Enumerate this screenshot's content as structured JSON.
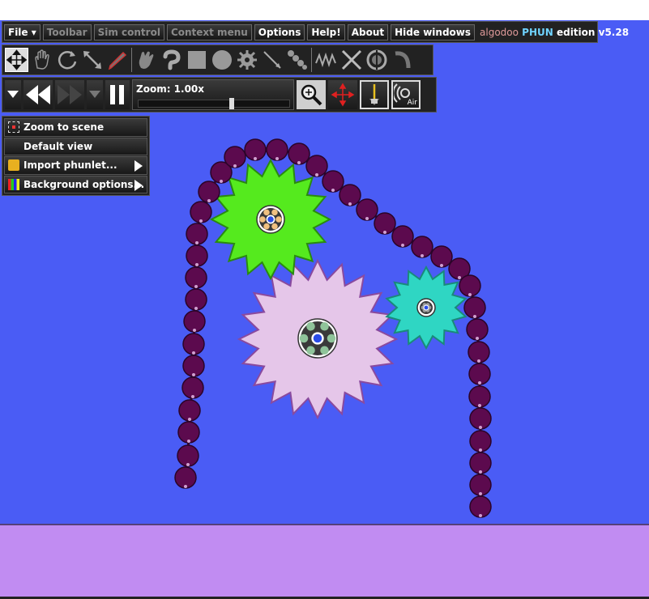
{
  "menubar": {
    "items": [
      {
        "label": "File ▾",
        "enabled": true
      },
      {
        "label": "Toolbar",
        "enabled": false
      },
      {
        "label": "Sim control",
        "enabled": false
      },
      {
        "label": "Context menu",
        "enabled": false
      },
      {
        "label": "Options",
        "enabled": true
      },
      {
        "label": "Help!",
        "enabled": true
      },
      {
        "label": "About",
        "enabled": true
      },
      {
        "label": "Hide windows",
        "enabled": true
      }
    ],
    "brand_prefix": "algodoo",
    "brand_name": "PHUN",
    "brand_suffix": "edition v5.28"
  },
  "toolbar": {
    "tools": [
      "move-tool-icon",
      "drag-hand-icon",
      "rotate-icon",
      "scale-icon",
      "sketch-pen-icon",
      "brush-icon",
      "plane-icon",
      "box-icon",
      "circle-icon",
      "gear-icon",
      "cut-knife-icon",
      "chain-icon",
      "spring-icon",
      "delete-x-icon",
      "fixate-icon",
      "tracer-icon"
    ],
    "selected": "move-tool-icon"
  },
  "sim": {
    "zoom_label": "Zoom: 1.00x",
    "zoom_level": 0.62,
    "air_label": "Air"
  },
  "context_menu": {
    "items": [
      {
        "label": "Zoom to scene",
        "icon": "zoom-scene-icon",
        "submenu": false
      },
      {
        "label": "Default view",
        "icon": "",
        "submenu": false
      },
      {
        "label": "Import phunlet...",
        "icon": "folder-icon",
        "submenu": true
      },
      {
        "label": "Background options...",
        "icon": "palette-icon",
        "submenu": true
      }
    ]
  },
  "colors": {
    "sky": "#4a5cf5",
    "ground": "#c18cf2",
    "chain": "#5c0a4e",
    "gear_green": "#55ea1e",
    "gear_pink": "#e5c6e9",
    "gear_teal": "#2fd6c3"
  }
}
